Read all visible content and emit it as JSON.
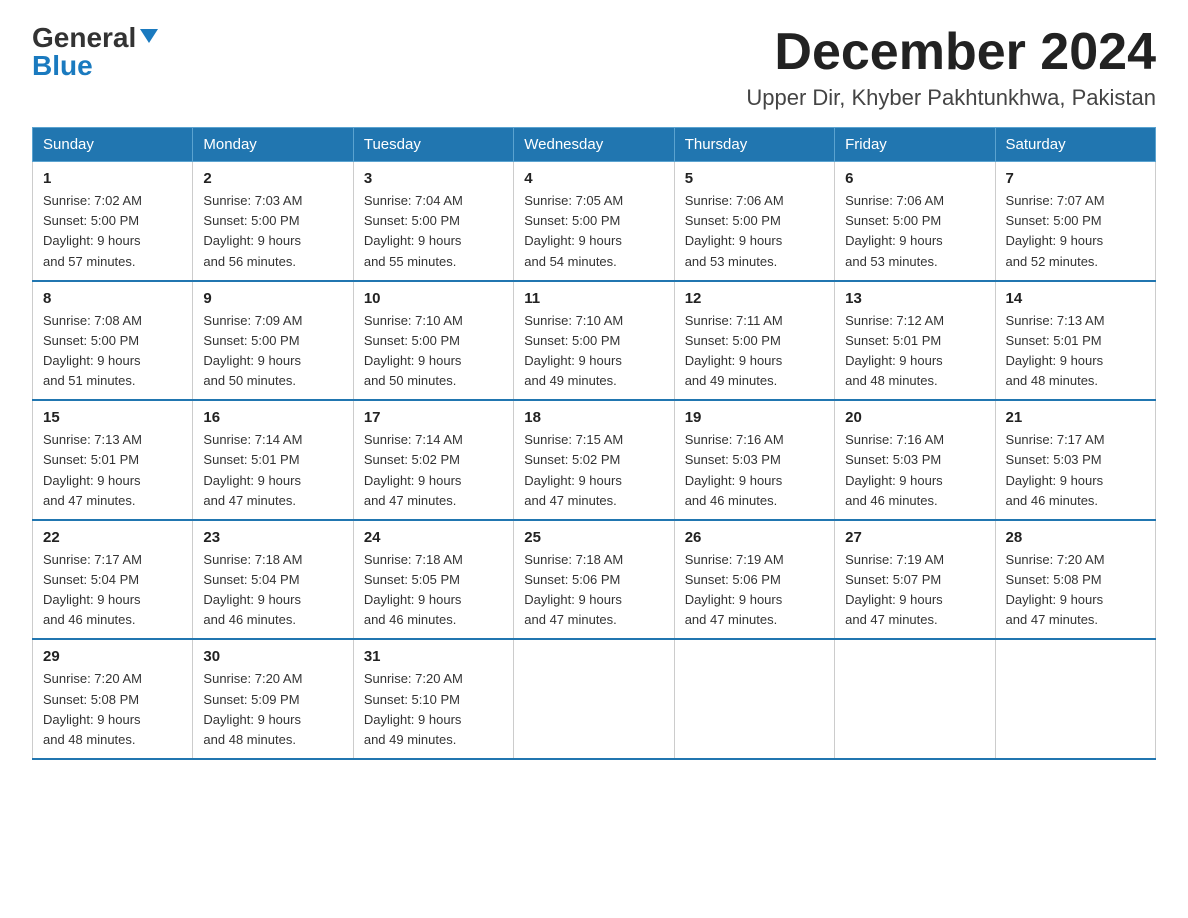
{
  "header": {
    "logo_general": "General",
    "logo_blue": "Blue",
    "month_year": "December 2024",
    "location": "Upper Dir, Khyber Pakhtunkhwa, Pakistan"
  },
  "days_of_week": [
    "Sunday",
    "Monday",
    "Tuesday",
    "Wednesday",
    "Thursday",
    "Friday",
    "Saturday"
  ],
  "weeks": [
    [
      {
        "day": "1",
        "sunrise": "7:02 AM",
        "sunset": "5:00 PM",
        "daylight": "9 hours and 57 minutes."
      },
      {
        "day": "2",
        "sunrise": "7:03 AM",
        "sunset": "5:00 PM",
        "daylight": "9 hours and 56 minutes."
      },
      {
        "day": "3",
        "sunrise": "7:04 AM",
        "sunset": "5:00 PM",
        "daylight": "9 hours and 55 minutes."
      },
      {
        "day": "4",
        "sunrise": "7:05 AM",
        "sunset": "5:00 PM",
        "daylight": "9 hours and 54 minutes."
      },
      {
        "day": "5",
        "sunrise": "7:06 AM",
        "sunset": "5:00 PM",
        "daylight": "9 hours and 53 minutes."
      },
      {
        "day": "6",
        "sunrise": "7:06 AM",
        "sunset": "5:00 PM",
        "daylight": "9 hours and 53 minutes."
      },
      {
        "day": "7",
        "sunrise": "7:07 AM",
        "sunset": "5:00 PM",
        "daylight": "9 hours and 52 minutes."
      }
    ],
    [
      {
        "day": "8",
        "sunrise": "7:08 AM",
        "sunset": "5:00 PM",
        "daylight": "9 hours and 51 minutes."
      },
      {
        "day": "9",
        "sunrise": "7:09 AM",
        "sunset": "5:00 PM",
        "daylight": "9 hours and 50 minutes."
      },
      {
        "day": "10",
        "sunrise": "7:10 AM",
        "sunset": "5:00 PM",
        "daylight": "9 hours and 50 minutes."
      },
      {
        "day": "11",
        "sunrise": "7:10 AM",
        "sunset": "5:00 PM",
        "daylight": "9 hours and 49 minutes."
      },
      {
        "day": "12",
        "sunrise": "7:11 AM",
        "sunset": "5:00 PM",
        "daylight": "9 hours and 49 minutes."
      },
      {
        "day": "13",
        "sunrise": "7:12 AM",
        "sunset": "5:01 PM",
        "daylight": "9 hours and 48 minutes."
      },
      {
        "day": "14",
        "sunrise": "7:13 AM",
        "sunset": "5:01 PM",
        "daylight": "9 hours and 48 minutes."
      }
    ],
    [
      {
        "day": "15",
        "sunrise": "7:13 AM",
        "sunset": "5:01 PM",
        "daylight": "9 hours and 47 minutes."
      },
      {
        "day": "16",
        "sunrise": "7:14 AM",
        "sunset": "5:01 PM",
        "daylight": "9 hours and 47 minutes."
      },
      {
        "day": "17",
        "sunrise": "7:14 AM",
        "sunset": "5:02 PM",
        "daylight": "9 hours and 47 minutes."
      },
      {
        "day": "18",
        "sunrise": "7:15 AM",
        "sunset": "5:02 PM",
        "daylight": "9 hours and 47 minutes."
      },
      {
        "day": "19",
        "sunrise": "7:16 AM",
        "sunset": "5:03 PM",
        "daylight": "9 hours and 46 minutes."
      },
      {
        "day": "20",
        "sunrise": "7:16 AM",
        "sunset": "5:03 PM",
        "daylight": "9 hours and 46 minutes."
      },
      {
        "day": "21",
        "sunrise": "7:17 AM",
        "sunset": "5:03 PM",
        "daylight": "9 hours and 46 minutes."
      }
    ],
    [
      {
        "day": "22",
        "sunrise": "7:17 AM",
        "sunset": "5:04 PM",
        "daylight": "9 hours and 46 minutes."
      },
      {
        "day": "23",
        "sunrise": "7:18 AM",
        "sunset": "5:04 PM",
        "daylight": "9 hours and 46 minutes."
      },
      {
        "day": "24",
        "sunrise": "7:18 AM",
        "sunset": "5:05 PM",
        "daylight": "9 hours and 46 minutes."
      },
      {
        "day": "25",
        "sunrise": "7:18 AM",
        "sunset": "5:06 PM",
        "daylight": "9 hours and 47 minutes."
      },
      {
        "day": "26",
        "sunrise": "7:19 AM",
        "sunset": "5:06 PM",
        "daylight": "9 hours and 47 minutes."
      },
      {
        "day": "27",
        "sunrise": "7:19 AM",
        "sunset": "5:07 PM",
        "daylight": "9 hours and 47 minutes."
      },
      {
        "day": "28",
        "sunrise": "7:20 AM",
        "sunset": "5:08 PM",
        "daylight": "9 hours and 47 minutes."
      }
    ],
    [
      {
        "day": "29",
        "sunrise": "7:20 AM",
        "sunset": "5:08 PM",
        "daylight": "9 hours and 48 minutes."
      },
      {
        "day": "30",
        "sunrise": "7:20 AM",
        "sunset": "5:09 PM",
        "daylight": "9 hours and 48 minutes."
      },
      {
        "day": "31",
        "sunrise": "7:20 AM",
        "sunset": "5:10 PM",
        "daylight": "9 hours and 49 minutes."
      },
      null,
      null,
      null,
      null
    ]
  ],
  "labels": {
    "sunrise_prefix": "Sunrise: ",
    "sunset_prefix": "Sunset: ",
    "daylight_prefix": "Daylight: "
  }
}
